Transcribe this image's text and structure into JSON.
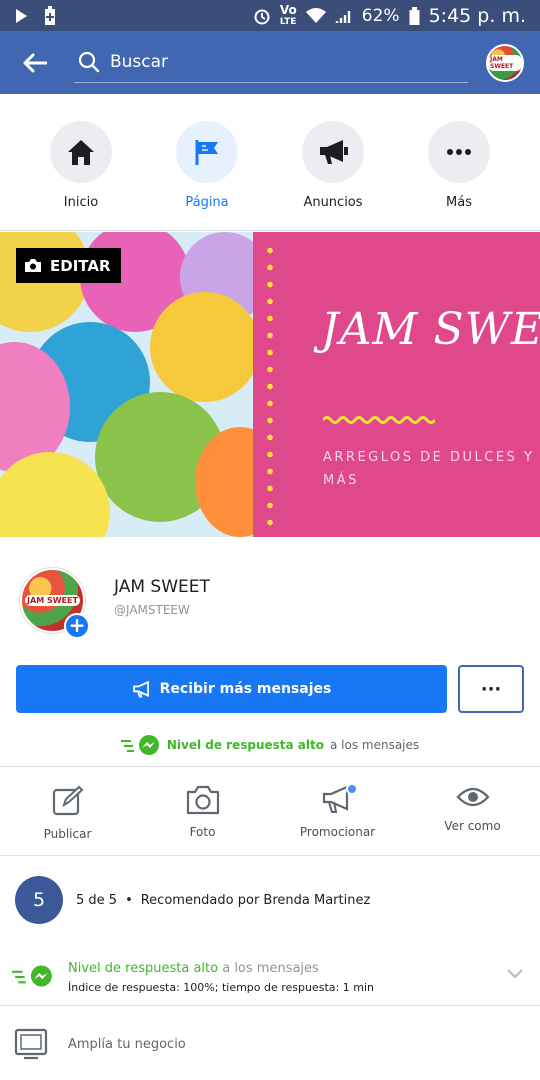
{
  "status_bar": {
    "network_top": "Vo",
    "network_bottom": "LTE",
    "battery": "62%",
    "time": "5:45 p. m."
  },
  "header": {
    "search_placeholder": "Buscar",
    "avatar_text": "JAM SWEET"
  },
  "nav": [
    {
      "label": "Inicio",
      "icon": "home-icon"
    },
    {
      "label": "Página",
      "icon": "flag-icon"
    },
    {
      "label": "Anuncios",
      "icon": "megaphone-icon"
    },
    {
      "label": "Más",
      "icon": "more-icon"
    }
  ],
  "cover": {
    "edit_label": "EDITAR",
    "brand_title": "JAM SWEE",
    "brand_sub_line1": "ARREGLOS DE DULCES Y",
    "brand_sub_line2": "MÁS",
    "accent_pink": "#e0488c",
    "accent_yellow": "#ffe234"
  },
  "page": {
    "name": "JAM SWEET",
    "handle": "@JAMSTEEW",
    "avatar_text": "JAM SWEET"
  },
  "primary_action": {
    "label": "Recibir más mensajes"
  },
  "more_button": {
    "label": "···"
  },
  "response": {
    "highlight": "Nivel de respuesta alto",
    "rest": "a los mensajes"
  },
  "actions": [
    {
      "label": "Publicar",
      "icon": "edit-icon"
    },
    {
      "label": "Foto",
      "icon": "camera-icon"
    },
    {
      "label": "Promocionar",
      "icon": "megaphone-icon"
    },
    {
      "label": "Ver como",
      "icon": "eye-icon"
    }
  ],
  "recommendation": {
    "badge": "5",
    "rating": "5 de 5",
    "separator": "•",
    "text": "Recomendado por Brenda Martinez"
  },
  "response_detail": {
    "highlight": "Nivel de respuesta alto",
    "rest": "a los mensajes",
    "detail": "Índice de respuesta: 100%; tiempo de respuesta: 1 min"
  },
  "grow": {
    "label": "Amplía tu negocio"
  },
  "colors": {
    "facebook_blue": "#4267b2",
    "button_blue": "#1877f2",
    "green": "#42b72a"
  }
}
